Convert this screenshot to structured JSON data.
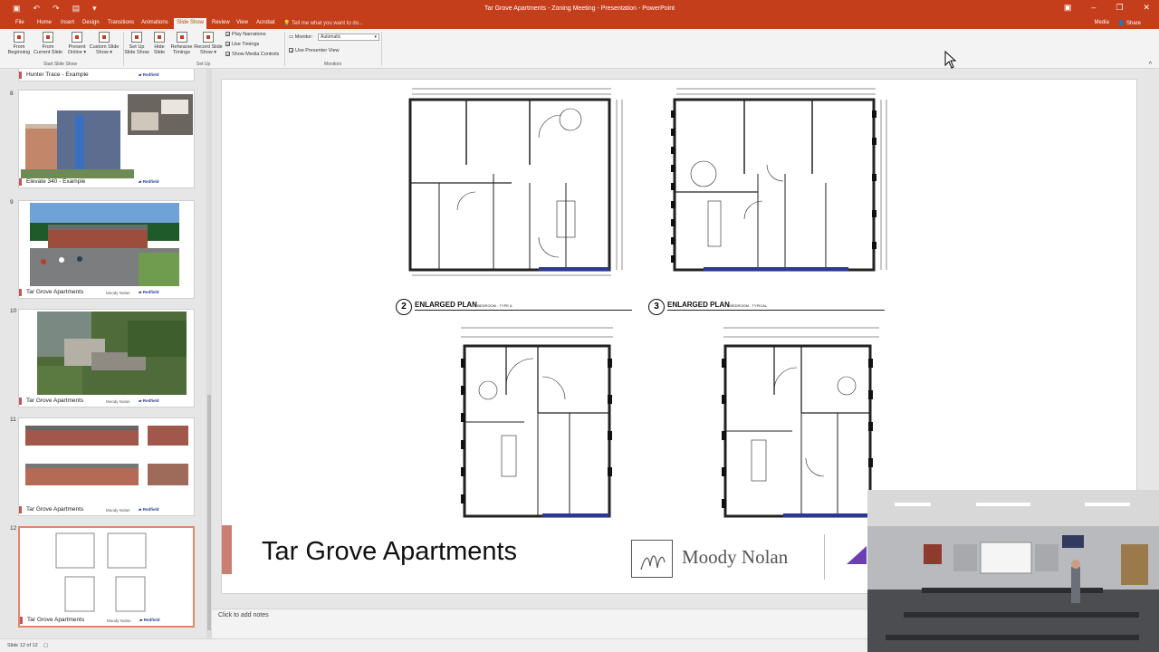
{
  "window": {
    "title": "Tar Grove Apartments - Zoning Meeting - Presentation - PowerPoint"
  },
  "menu": {
    "tabs": [
      "File",
      "Home",
      "Insert",
      "Design",
      "Transitions",
      "Animations",
      "Slide Show",
      "Review",
      "View",
      "Acrobat"
    ],
    "active_tab": "Slide Show",
    "tell_me": "Tell me what you want to do...",
    "media": "Media",
    "share": "Share"
  },
  "ribbon": {
    "start_group": {
      "label": "Start Slide Show",
      "buttons": [
        {
          "line1": "From",
          "line2": "Beginning"
        },
        {
          "line1": "From",
          "line2": "Current Slide"
        },
        {
          "line1": "Present",
          "line2": "Online ▾"
        },
        {
          "line1": "Custom Slide",
          "line2": "Show ▾"
        }
      ]
    },
    "setup_group": {
      "label": "Set Up",
      "buttons": [
        {
          "line1": "Set Up",
          "line2": "Slide Show"
        },
        {
          "line1": "Hide",
          "line2": "Slide"
        },
        {
          "line1": "Rehearse",
          "line2": "Timings"
        },
        {
          "line1": "Record Slide",
          "line2": "Show ▾"
        }
      ],
      "checks": [
        "Play Narrations",
        "Use Timings",
        "Show Media Controls"
      ]
    },
    "monitors_group": {
      "label": "Monitors",
      "monitor_label": "Monitor:",
      "monitor_value": "Automatic",
      "presenter_view": "Use Presenter View"
    }
  },
  "thumbnails": [
    {
      "num": "",
      "caption": "Hunter Trace - Example"
    },
    {
      "num": "8",
      "caption": "Elevate 340 - Example"
    },
    {
      "num": "9",
      "caption": "Tar Grove Apartments",
      "logo1": "Moody Nolan"
    },
    {
      "num": "10",
      "caption": "Tar Grove Apartments",
      "logo1": "Moody Nolan"
    },
    {
      "num": "11",
      "caption": "Tar Grove Apartments",
      "logo1": "Moody Nolan"
    },
    {
      "num": "12",
      "caption": "Tar Grove Apartments",
      "logo1": "Moody Nolan"
    }
  ],
  "slide": {
    "title": "Tar Grove Apartments",
    "brand": "Moody Nolan",
    "plans": [
      {
        "num": "2",
        "label": "ENLARGED PLAN",
        "sub": "2 BEDROOM - TYPE A"
      },
      {
        "num": "3",
        "label": "ENLARGED PLAN",
        "sub": "2 BEDROOM - TYPICAL"
      }
    ]
  },
  "notes": {
    "placeholder": "Click to add notes"
  },
  "status": {
    "slide_indicator": "Slide 12 of 12"
  },
  "colors": {
    "accent": "#c43e1c",
    "slide_accent": "#c98070",
    "brand_purple": "#6a3fb3"
  }
}
